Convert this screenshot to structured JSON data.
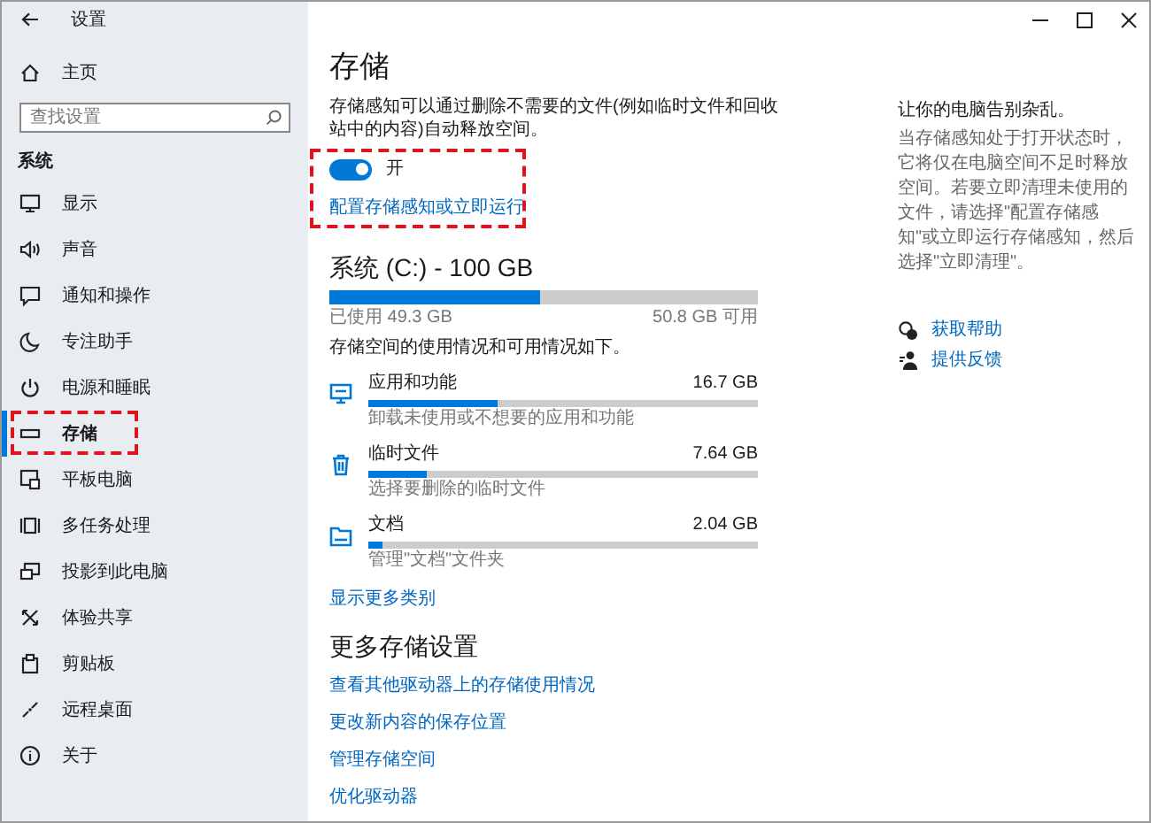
{
  "window": {
    "title": "设置"
  },
  "sidebar": {
    "home": "主页",
    "search": {
      "placeholder": "查找设置"
    },
    "section": "系统",
    "items": [
      {
        "label": "显示",
        "selected": false,
        "highlighted": false
      },
      {
        "label": "声音",
        "selected": false,
        "highlighted": false
      },
      {
        "label": "通知和操作",
        "selected": false,
        "highlighted": false
      },
      {
        "label": "专注助手",
        "selected": false,
        "highlighted": false
      },
      {
        "label": "电源和睡眠",
        "selected": false,
        "highlighted": false
      },
      {
        "label": "存储",
        "selected": true,
        "highlighted": true
      },
      {
        "label": "平板电脑",
        "selected": false,
        "highlighted": false
      },
      {
        "label": "多任务处理",
        "selected": false,
        "highlighted": false
      },
      {
        "label": "投影到此电脑",
        "selected": false,
        "highlighted": false
      },
      {
        "label": "体验共享",
        "selected": false,
        "highlighted": false
      },
      {
        "label": "剪贴板",
        "selected": false,
        "highlighted": false
      },
      {
        "label": "远程桌面",
        "selected": false,
        "highlighted": false
      },
      {
        "label": "关于",
        "selected": false,
        "highlighted": false
      }
    ]
  },
  "page": {
    "title": "存储",
    "description": "存储感知可以通过删除不需要的文件(例如临时文件和回收站中的内容)自动释放空间。",
    "storage_sense": {
      "on": true,
      "state_label": "开",
      "link": "配置存储感知或立即运行",
      "highlighted": true
    },
    "drive": {
      "title": "系统 (C:) - 100 GB",
      "level": 0.493,
      "used": "已使用 49.3 GB",
      "free": "50.8 GB 可用"
    },
    "usage_intro": "存储空间的使用情况和可用情况如下。",
    "categories": [
      {
        "name": "应用和功能",
        "size": "16.7 GB",
        "level": 0.33,
        "hint": "卸载未使用或不想要的应用和功能"
      },
      {
        "name": "临时文件",
        "size": "7.64 GB",
        "level": 0.15,
        "hint": "选择要删除的临时文件"
      },
      {
        "name": "文档",
        "size": "2.04 GB",
        "level": 0.035,
        "hint": "管理\"文档\"文件夹"
      }
    ],
    "more_link": "显示更多类别",
    "more_settings": {
      "title": "更多存储设置",
      "links": [
        "查看其他驱动器上的存储使用情况",
        "更改新内容的保存位置",
        "管理存储空间",
        "优化驱动器"
      ]
    }
  },
  "help_panel": {
    "title": "让你的电脑告别杂乱。",
    "text": "当存储感知处于打开状态时，它将仅在电脑空间不足时释放空间。若要立即清理未使用的文件，请选择\"配置存储感知\"或立即运行存储感知，然后选择\"立即清理\"。",
    "links": [
      "获取帮助",
      "提供反馈"
    ]
  }
}
